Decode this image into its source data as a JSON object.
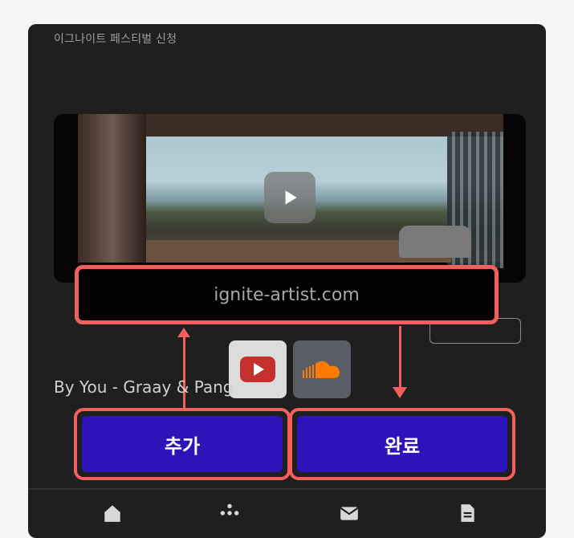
{
  "app": {
    "title": "이그나이트 페스티벌 신청"
  },
  "video": {
    "play_icon": "play-icon"
  },
  "link": {
    "url": "ignite-artist.com"
  },
  "sources": [
    {
      "name": "youtube",
      "icon": "youtube-icon",
      "color": "#c4302b"
    },
    {
      "name": "soundcloud",
      "icon": "soundcloud-icon",
      "color": "#ff7a00"
    }
  ],
  "track": {
    "title": "By You - Graay & Pang"
  },
  "buttons": {
    "add_label": "추가",
    "done_label": "완료"
  },
  "bottom_nav": [
    {
      "icon": "home-icon"
    },
    {
      "icon": "dots-icon"
    },
    {
      "icon": "mail-icon"
    },
    {
      "icon": "document-icon"
    }
  ],
  "colors": {
    "accent": "#2d14b8",
    "highlight": "#f25f5c",
    "background": "#1f1f1f"
  }
}
